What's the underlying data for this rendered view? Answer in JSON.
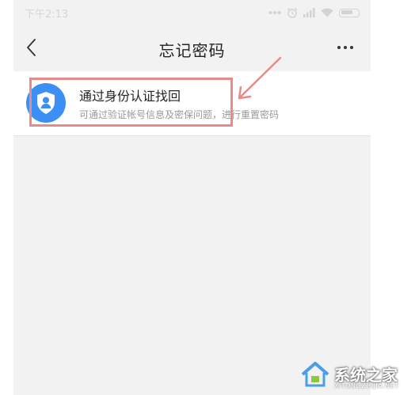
{
  "status_bar": {
    "time": "下午2:13"
  },
  "nav": {
    "title": "忘记密码"
  },
  "option": {
    "title": "通过身份认证找回",
    "description": "可通过验证帐号信息及密保问题，进行重置密码",
    "icon": "shield-user-icon",
    "icon_color": "#3b8ff5"
  },
  "annotation": {
    "box_color": "#e88a8a"
  },
  "watermark": {
    "text": "系统之家",
    "sub": "XITONGZHIJIA.NET"
  }
}
